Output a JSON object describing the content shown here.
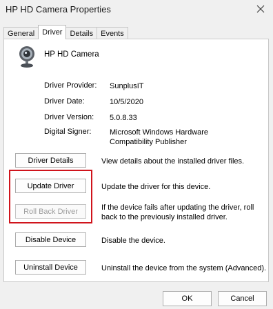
{
  "window": {
    "title": "HP HD Camera Properties"
  },
  "tabs": [
    {
      "label": "General"
    },
    {
      "label": "Driver"
    },
    {
      "label": "Details"
    },
    {
      "label": "Events"
    }
  ],
  "active_tab": "Driver",
  "device": {
    "name": "HP HD Camera",
    "icon": "webcam-icon"
  },
  "info": [
    {
      "label": "Driver Provider:",
      "value": "SunplusIT"
    },
    {
      "label": "Driver Date:",
      "value": "10/5/2020"
    },
    {
      "label": "Driver Version:",
      "value": "5.0.8.33"
    },
    {
      "label": "Digital Signer:",
      "value": "Microsoft Windows Hardware Compatibility Publisher"
    }
  ],
  "actions": [
    {
      "label": "Driver Details",
      "description": "View details about the installed driver files.",
      "enabled": true
    },
    {
      "label": "Update Driver",
      "description": "Update the driver for this device.",
      "enabled": true
    },
    {
      "label": "Roll Back Driver",
      "description": "If the device fails after updating the driver, roll back to the previously installed driver.",
      "enabled": false
    },
    {
      "label": "Disable Device",
      "description": "Disable the device.",
      "enabled": true
    },
    {
      "label": "Uninstall Device",
      "description": "Uninstall the device from the system (Advanced).",
      "enabled": true
    }
  ],
  "highlight_color": "#d0141c",
  "footer": {
    "ok_label": "OK",
    "cancel_label": "Cancel"
  }
}
